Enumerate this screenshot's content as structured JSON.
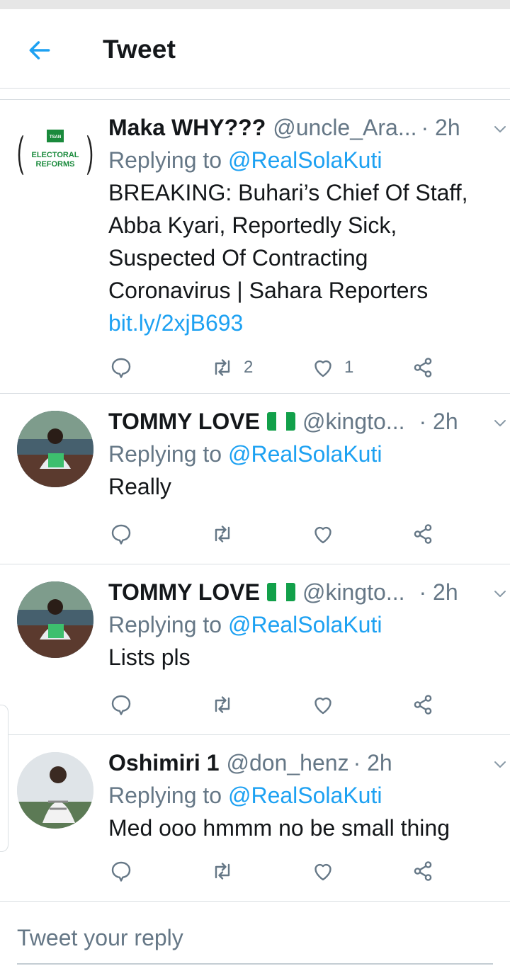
{
  "header": {
    "title": "Tweet"
  },
  "tweets": [
    {
      "display_name": "Maka WHY???",
      "handle": "@uncle_Ara...",
      "time": "· 2h",
      "replying_prefix": "Replying to",
      "replying_to": "@RealSolaKuti",
      "text": "BREAKING: Buhari’s Chief Of Staff, Abba Kyari, Reportedly Sick, Suspected Of Contracting Coronavirus | Sahara Reporters",
      "link": "bit.ly/2xjB693",
      "retweets": "2",
      "likes": "1",
      "avatar_logo_top": "ELECTORAL",
      "avatar_logo_bottom": "REFORMS",
      "avatar_logo_badge": "TSAN"
    },
    {
      "display_name": "TOMMY LOVE",
      "handle": "@kingto...",
      "time": "· 2h",
      "replying_prefix": "Replying to",
      "replying_to": "@RealSolaKuti",
      "text": "Really"
    },
    {
      "display_name": "TOMMY LOVE",
      "handle": "@kingto...",
      "time": "· 2h",
      "replying_prefix": "Replying to",
      "replying_to": "@RealSolaKuti",
      "text": "Lists pls"
    },
    {
      "display_name": "Oshimiri 1",
      "handle": "@don_henz",
      "time": "· 2h",
      "replying_prefix": "Replying to",
      "replying_to": "@RealSolaKuti",
      "text": "Med ooo hmmm no be small thing"
    }
  ],
  "composer": {
    "placeholder": "Tweet your reply"
  },
  "icons": {
    "back": "arrow-left-icon",
    "more": "chevron-down-icon",
    "reply": "reply-bubble-icon",
    "retweet": "retweet-icon",
    "like": "heart-icon",
    "share": "share-icon",
    "flag": "nigeria-flag-icon"
  },
  "colors": {
    "accent": "#1da1f2",
    "secondary_text": "#657786",
    "primary_text": "#14171a",
    "divider": "#d9dee2",
    "flag_green": "#12a04a"
  }
}
